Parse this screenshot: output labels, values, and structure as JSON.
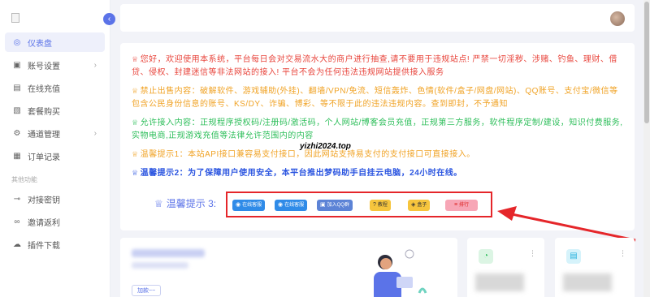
{
  "sidebar": {
    "items": [
      {
        "label": "仪表盘",
        "icon": "dashboard-icon",
        "glyph": "◎",
        "active": true
      },
      {
        "label": "账号设置",
        "icon": "account-icon",
        "glyph": "▣",
        "arrow": "›"
      },
      {
        "label": "在线充值",
        "icon": "recharge-icon",
        "glyph": "▤"
      },
      {
        "label": "套餐购买",
        "icon": "package-icon",
        "glyph": "▧"
      },
      {
        "label": "通道管理",
        "icon": "channel-icon",
        "glyph": "⚙",
        "arrow": "›"
      },
      {
        "label": "订单记录",
        "icon": "order-icon",
        "glyph": "▦"
      }
    ],
    "section_title": "其他功能",
    "other_items": [
      {
        "label": "对接密钥",
        "icon": "key-icon",
        "glyph": "⊸"
      },
      {
        "label": "邀请返利",
        "icon": "link-icon",
        "glyph": "∞"
      },
      {
        "label": "插件下载",
        "icon": "cloud-download-icon",
        "glyph": "☁"
      }
    ],
    "collapse_glyph": "‹"
  },
  "notice": {
    "line1": "您好，欢迎使用本系统，平台每日会对交易流水大的商户进行抽查,请不要用于违规站点! 严禁一切淫秽、涉赌、钓鱼、理财、借贷、侵权、封建迷信等非法网站的接入! 平台不会为任何违法违规网站提供接入服务",
    "line2": "禁止出售内容：破解软件、游戏辅助(外挂)、翻墙/VPN/免流、短信轰炸、色情(软件/盒子/网盘/网站)、QQ账号、支付宝/微信等包含公民身份信息的账号、KS/DY、诈骗、博彩、等不限于此的违法违规内容。查到即封，不予通知",
    "line3": "允许接入内容：正规程序授权码/注册码/激活码，个人网站/博客会员充值，正规第三方服务，软件程序定制/建设，知识付费服务,实物电商,正规游戏充值等法律允许范围内的内容",
    "line4": "温馨提示1：本站API接口兼容易支付接口，因此网站支持易支付的支付接口可直接接入。",
    "line5": "温馨提示2：为了保障用户使用安全，本平台推出梦码助手自挂云电脑，24小时在线。",
    "tips3": "温馨提示 3:",
    "watermark": "yizhi2024.top",
    "crown": "♕"
  },
  "buttons": {
    "kefu1": "在线客服",
    "kefu2": "在线客服",
    "qq": "加入QQ群",
    "tutorial": "教程",
    "box": "盒子",
    "rank": "排行"
  },
  "cards": {
    "add_label": "加款~~",
    "dots": "⋮"
  },
  "colors": {
    "accent": "#5b73e8",
    "red": "#e8453c",
    "orange": "#f0a326",
    "green": "#2dbe5a",
    "blue": "#2b55e0"
  }
}
